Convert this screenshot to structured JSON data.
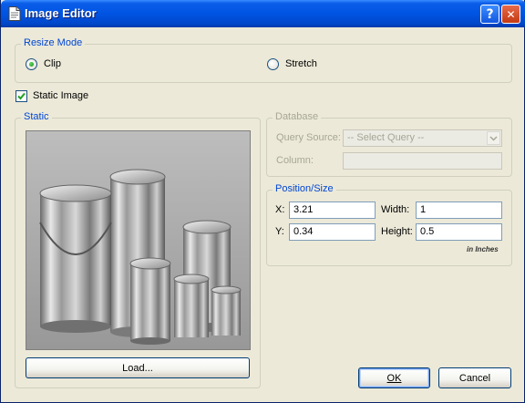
{
  "window": {
    "title": "Image Editor",
    "help_symbol": "?",
    "close_symbol": "✕",
    "icons": [
      "document-icon",
      "help-icon",
      "close-icon"
    ]
  },
  "resize_mode": {
    "legend": "Resize Mode",
    "options": [
      {
        "label": "Clip",
        "selected": true
      },
      {
        "label": "Stretch",
        "selected": false
      }
    ]
  },
  "static_image": {
    "label": "Static Image",
    "checked": true
  },
  "static": {
    "legend": "Static",
    "load_button": "Load..."
  },
  "database": {
    "legend": "Database",
    "query_source_label": "Query Source:",
    "query_source_value": "-- Select Query --",
    "column_label": "Column:",
    "column_value": ""
  },
  "position_size": {
    "legend": "Position/Size",
    "x_label": "X:",
    "x_value": "3.21",
    "y_label": "Y:",
    "y_value": "0.34",
    "width_label": "Width:",
    "width_value": "1",
    "height_label": "Height:",
    "height_value": "0.5",
    "units_note": "in Inches"
  },
  "buttons": {
    "ok": "OK",
    "cancel": "Cancel"
  }
}
